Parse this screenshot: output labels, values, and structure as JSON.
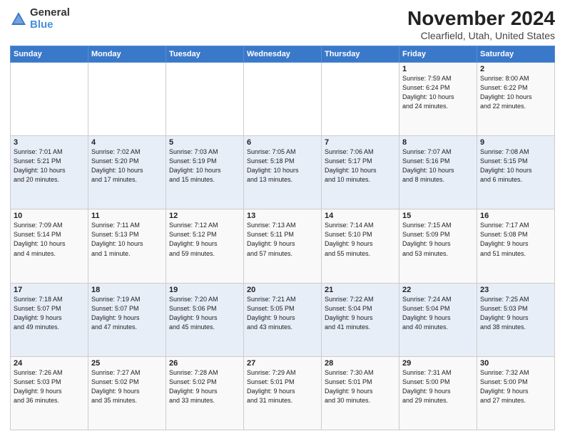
{
  "logo": {
    "general": "General",
    "blue": "Blue"
  },
  "header": {
    "month": "November 2024",
    "location": "Clearfield, Utah, United States"
  },
  "weekdays": [
    "Sunday",
    "Monday",
    "Tuesday",
    "Wednesday",
    "Thursday",
    "Friday",
    "Saturday"
  ],
  "weeks": [
    [
      {
        "day": "",
        "info": ""
      },
      {
        "day": "",
        "info": ""
      },
      {
        "day": "",
        "info": ""
      },
      {
        "day": "",
        "info": ""
      },
      {
        "day": "",
        "info": ""
      },
      {
        "day": "1",
        "info": "Sunrise: 7:59 AM\nSunset: 6:24 PM\nDaylight: 10 hours\nand 24 minutes."
      },
      {
        "day": "2",
        "info": "Sunrise: 8:00 AM\nSunset: 6:22 PM\nDaylight: 10 hours\nand 22 minutes."
      }
    ],
    [
      {
        "day": "3",
        "info": "Sunrise: 7:01 AM\nSunset: 5:21 PM\nDaylight: 10 hours\nand 20 minutes."
      },
      {
        "day": "4",
        "info": "Sunrise: 7:02 AM\nSunset: 5:20 PM\nDaylight: 10 hours\nand 17 minutes."
      },
      {
        "day": "5",
        "info": "Sunrise: 7:03 AM\nSunset: 5:19 PM\nDaylight: 10 hours\nand 15 minutes."
      },
      {
        "day": "6",
        "info": "Sunrise: 7:05 AM\nSunset: 5:18 PM\nDaylight: 10 hours\nand 13 minutes."
      },
      {
        "day": "7",
        "info": "Sunrise: 7:06 AM\nSunset: 5:17 PM\nDaylight: 10 hours\nand 10 minutes."
      },
      {
        "day": "8",
        "info": "Sunrise: 7:07 AM\nSunset: 5:16 PM\nDaylight: 10 hours\nand 8 minutes."
      },
      {
        "day": "9",
        "info": "Sunrise: 7:08 AM\nSunset: 5:15 PM\nDaylight: 10 hours\nand 6 minutes."
      }
    ],
    [
      {
        "day": "10",
        "info": "Sunrise: 7:09 AM\nSunset: 5:14 PM\nDaylight: 10 hours\nand 4 minutes."
      },
      {
        "day": "11",
        "info": "Sunrise: 7:11 AM\nSunset: 5:13 PM\nDaylight: 10 hours\nand 1 minute."
      },
      {
        "day": "12",
        "info": "Sunrise: 7:12 AM\nSunset: 5:12 PM\nDaylight: 9 hours\nand 59 minutes."
      },
      {
        "day": "13",
        "info": "Sunrise: 7:13 AM\nSunset: 5:11 PM\nDaylight: 9 hours\nand 57 minutes."
      },
      {
        "day": "14",
        "info": "Sunrise: 7:14 AM\nSunset: 5:10 PM\nDaylight: 9 hours\nand 55 minutes."
      },
      {
        "day": "15",
        "info": "Sunrise: 7:15 AM\nSunset: 5:09 PM\nDaylight: 9 hours\nand 53 minutes."
      },
      {
        "day": "16",
        "info": "Sunrise: 7:17 AM\nSunset: 5:08 PM\nDaylight: 9 hours\nand 51 minutes."
      }
    ],
    [
      {
        "day": "17",
        "info": "Sunrise: 7:18 AM\nSunset: 5:07 PM\nDaylight: 9 hours\nand 49 minutes."
      },
      {
        "day": "18",
        "info": "Sunrise: 7:19 AM\nSunset: 5:07 PM\nDaylight: 9 hours\nand 47 minutes."
      },
      {
        "day": "19",
        "info": "Sunrise: 7:20 AM\nSunset: 5:06 PM\nDaylight: 9 hours\nand 45 minutes."
      },
      {
        "day": "20",
        "info": "Sunrise: 7:21 AM\nSunset: 5:05 PM\nDaylight: 9 hours\nand 43 minutes."
      },
      {
        "day": "21",
        "info": "Sunrise: 7:22 AM\nSunset: 5:04 PM\nDaylight: 9 hours\nand 41 minutes."
      },
      {
        "day": "22",
        "info": "Sunrise: 7:24 AM\nSunset: 5:04 PM\nDaylight: 9 hours\nand 40 minutes."
      },
      {
        "day": "23",
        "info": "Sunrise: 7:25 AM\nSunset: 5:03 PM\nDaylight: 9 hours\nand 38 minutes."
      }
    ],
    [
      {
        "day": "24",
        "info": "Sunrise: 7:26 AM\nSunset: 5:03 PM\nDaylight: 9 hours\nand 36 minutes."
      },
      {
        "day": "25",
        "info": "Sunrise: 7:27 AM\nSunset: 5:02 PM\nDaylight: 9 hours\nand 35 minutes."
      },
      {
        "day": "26",
        "info": "Sunrise: 7:28 AM\nSunset: 5:02 PM\nDaylight: 9 hours\nand 33 minutes."
      },
      {
        "day": "27",
        "info": "Sunrise: 7:29 AM\nSunset: 5:01 PM\nDaylight: 9 hours\nand 31 minutes."
      },
      {
        "day": "28",
        "info": "Sunrise: 7:30 AM\nSunset: 5:01 PM\nDaylight: 9 hours\nand 30 minutes."
      },
      {
        "day": "29",
        "info": "Sunrise: 7:31 AM\nSunset: 5:00 PM\nDaylight: 9 hours\nand 29 minutes."
      },
      {
        "day": "30",
        "info": "Sunrise: 7:32 AM\nSunset: 5:00 PM\nDaylight: 9 hours\nand 27 minutes."
      }
    ]
  ]
}
